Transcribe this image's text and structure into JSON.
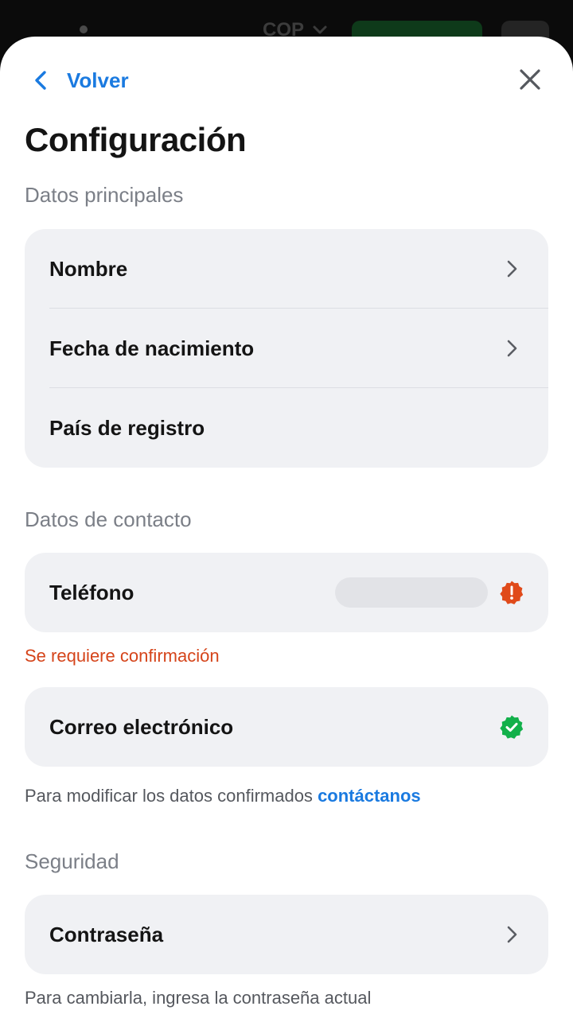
{
  "backdrop": {
    "currency": "COP"
  },
  "nav": {
    "back_label": "Volver"
  },
  "page": {
    "title": "Configuración"
  },
  "sections": {
    "main": {
      "label": "Datos principales",
      "items": [
        "Nombre",
        "Fecha de nacimiento",
        "País de registro"
      ]
    },
    "contact": {
      "label": "Datos de contacto",
      "phone_label": "Teléfono",
      "phone_warning": "Se requiere confirmación",
      "email_label": "Correo electrónico",
      "helper_text": "Para modificar los datos confirmados",
      "helper_link": "contáctanos"
    },
    "security": {
      "label": "Seguridad",
      "password_label": "Contraseña",
      "helper_text": "Para cambiarla, ingresa la contraseña actual"
    }
  },
  "colors": {
    "accent": "#1a7ae0",
    "warning": "#e04a1a",
    "success": "#12b04a"
  },
  "icons": {
    "back": "chevron-left-icon",
    "close": "close-icon",
    "row_chevron": "chevron-right-icon",
    "warning": "warning-badge-icon",
    "verified": "verified-badge-icon"
  }
}
